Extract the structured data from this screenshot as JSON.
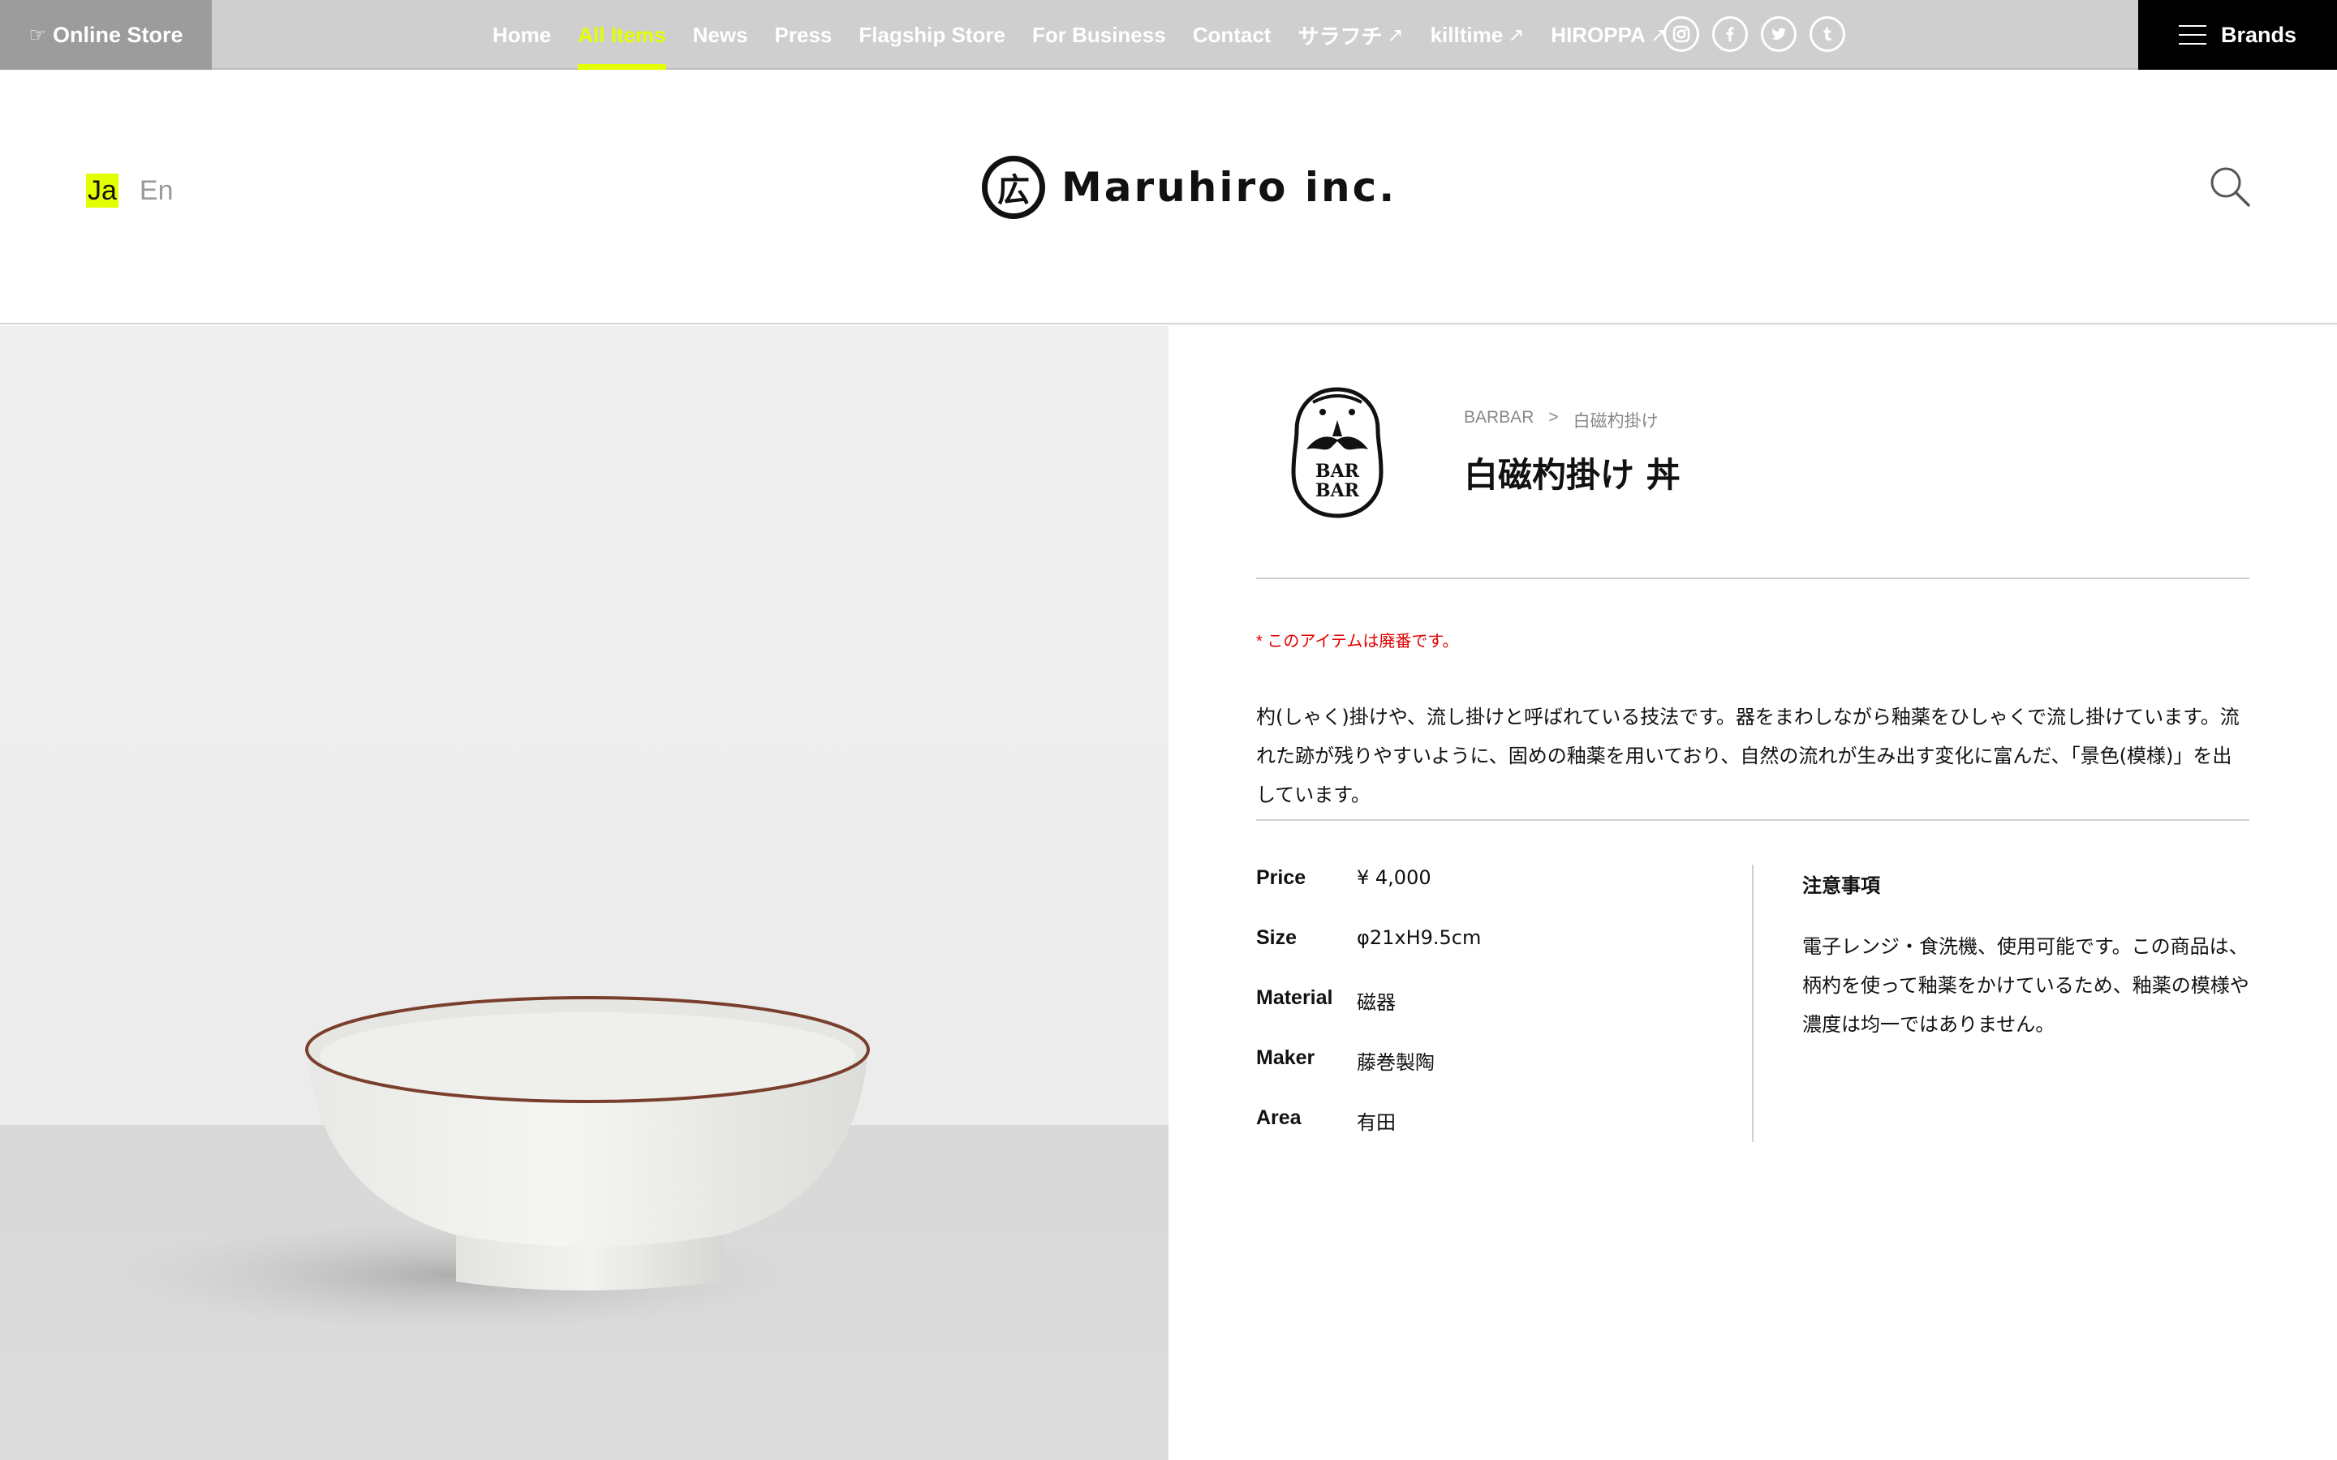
{
  "topbar": {
    "online_store": {
      "icon": "pointing-hand-icon",
      "label": "Online Store"
    },
    "nav": [
      {
        "label": "Home",
        "active": false,
        "external": false
      },
      {
        "label": "All Items",
        "active": true,
        "external": false
      },
      {
        "label": "News",
        "active": false,
        "external": false
      },
      {
        "label": "Press",
        "active": false,
        "external": false
      },
      {
        "label": "Flagship Store",
        "active": false,
        "external": false
      },
      {
        "label": "For Business",
        "active": false,
        "external": false
      },
      {
        "label": "Contact",
        "active": false,
        "external": false
      },
      {
        "label": "サラフチ",
        "active": false,
        "external": true
      },
      {
        "label": "killtime",
        "active": false,
        "external": true
      },
      {
        "label": "HIROPPA",
        "active": false,
        "external": true
      }
    ],
    "external_arrow": "↗",
    "socials": [
      {
        "icon": "instagram-icon",
        "glyph": "◎"
      },
      {
        "icon": "facebook-icon",
        "glyph": "f"
      },
      {
        "icon": "twitter-icon",
        "glyph": "✈"
      },
      {
        "icon": "tumblr-icon",
        "glyph": "t"
      }
    ],
    "brands_label": "Brands"
  },
  "header": {
    "lang_ja": "Ja",
    "lang_en": "En",
    "logo_mark": "広",
    "logo_text": "Maruhiro inc."
  },
  "product": {
    "breadcrumb": [
      "BARBAR",
      ">",
      "白磁杓掛け"
    ],
    "brand_logo_text": [
      "BAR",
      "BAR"
    ],
    "title": "白磁杓掛け 丼",
    "discontinued": "* このアイテムは廃番です。",
    "description": "杓(しゃく)掛けや、流し掛けと呼ばれている技法です。器をまわしながら釉薬をひしゃくで流し掛けています。流れた跡が残りやすいように、固めの釉薬を用いており、自然の流れが生み出す変化に富んだ、「景色(模様)」を出しています。",
    "specs": [
      {
        "label": "Price",
        "value": "¥ 4,000"
      },
      {
        "label": "Size",
        "value": "φ21xH9.5cm"
      },
      {
        "label": "Material",
        "value": "磁器"
      },
      {
        "label": "Maker",
        "value": "藤巻製陶"
      },
      {
        "label": "Area",
        "value": "有田"
      }
    ],
    "notes_title": "注意事項",
    "notes_text": "電子レンジ・食洗機、使用可能です。この商品は、柄杓を使って釉薬をかけているため、釉薬の模様や濃度は均一ではありません。"
  },
  "colors": {
    "accent": "#e3ff00",
    "topbar_bg": "#cfcfcf",
    "online_store_bg": "#9c9c9c",
    "brands_bg": "#000000",
    "discontinued": "#e00000"
  }
}
